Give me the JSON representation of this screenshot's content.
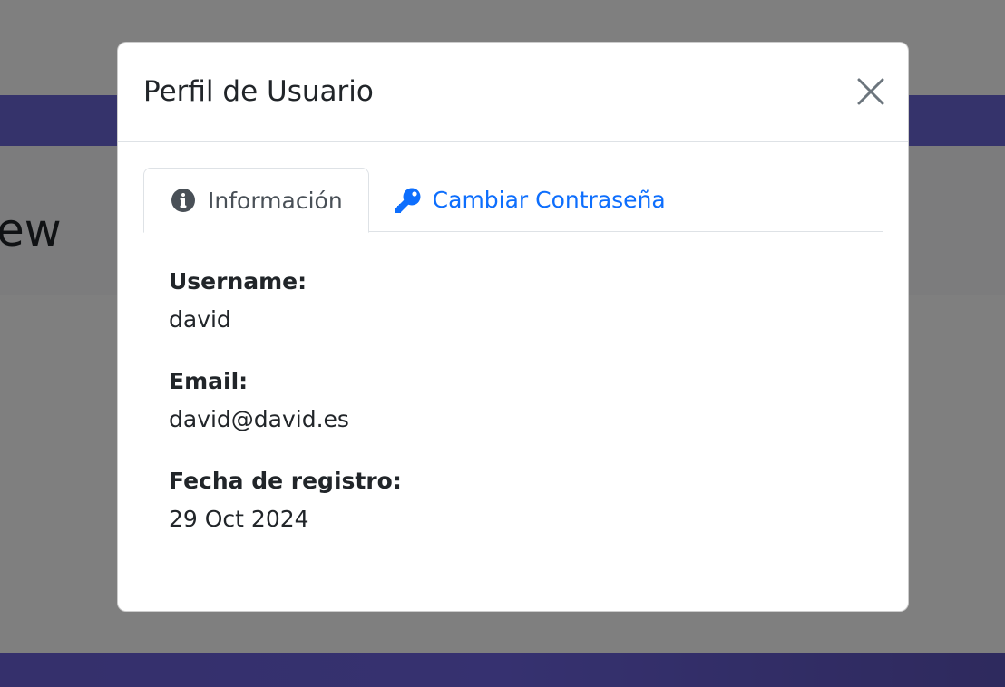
{
  "background": {
    "heading_fragment": "ew"
  },
  "modal": {
    "title": "Perfil de Usuario",
    "close_icon": "close-icon",
    "tabs": [
      {
        "label": "Información",
        "icon": "info-circle-icon",
        "active": true
      },
      {
        "label": "Cambiar Contraseña",
        "icon": "key-icon",
        "active": false
      }
    ],
    "fields": [
      {
        "label": "Username:",
        "value": "david"
      },
      {
        "label": "Email:",
        "value": "david@david.es"
      },
      {
        "label": "Fecha de registro:",
        "value": "29 Oct 2024"
      }
    ]
  },
  "colors": {
    "navbar": "#6a66d6",
    "link": "#0d6efd",
    "text": "#212529",
    "tab_active_text": "#495057",
    "border": "#dee2e6"
  }
}
